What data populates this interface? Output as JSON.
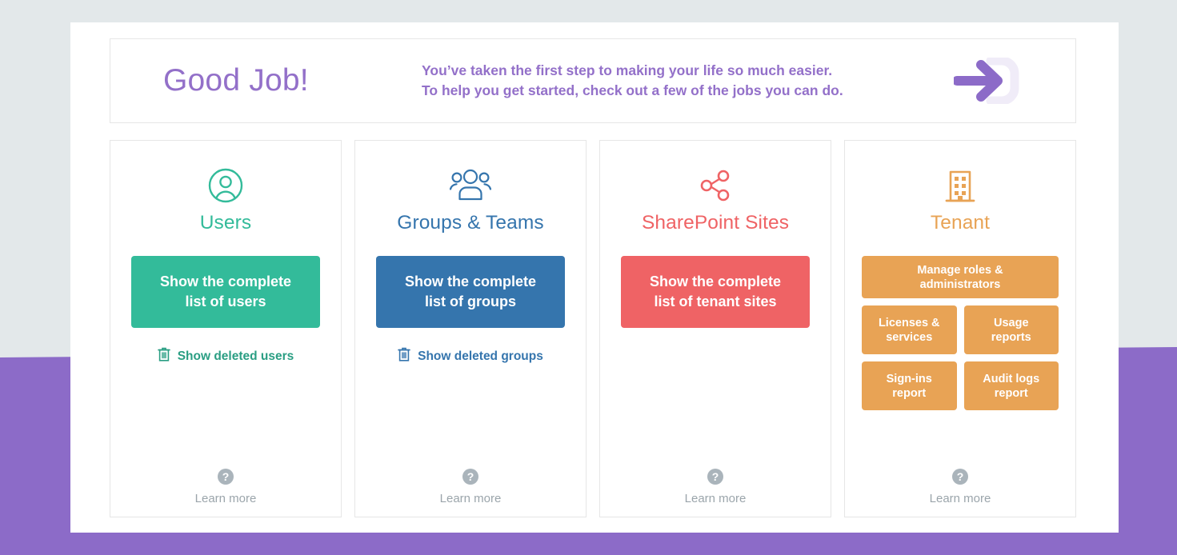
{
  "theme": {
    "background_top": "#e3e8ea",
    "background_bottom": "#8c6bc8",
    "panel": "#ffffff",
    "accent_purple": "#9370c9",
    "users_color": "#33bb9a",
    "groups_color": "#3575ad",
    "sharepoint_color": "#ef6365",
    "tenant_color": "#e8a355",
    "muted_gray": "#9ba5ab"
  },
  "banner": {
    "title": "Good Job!",
    "subtitle_line1": "You’ve taken the first step to making your life so much easier.",
    "subtitle_line2": "To help you get started, check out a few of the jobs you can do.",
    "icon": "arrow-enter-icon"
  },
  "cards": [
    {
      "id": "users",
      "icon": "user-circle-icon",
      "title": "Users",
      "color": "#33bb9a",
      "primary_button": "Show the complete list of users",
      "primary_button_line1": "Show the complete",
      "primary_button_line2": "list of users",
      "deleted_link": "Show deleted users",
      "deleted_icon": "trash-icon",
      "learn_more": "Learn more",
      "learn_more_icon": "question-mark-icon"
    },
    {
      "id": "groups",
      "icon": "people-group-icon",
      "title": "Groups & Teams",
      "color": "#3575ad",
      "primary_button": "Show the complete list of groups",
      "primary_button_line1": "Show the complete",
      "primary_button_line2": "list of groups",
      "deleted_link": "Show deleted groups",
      "deleted_icon": "trash-icon",
      "learn_more": "Learn more",
      "learn_more_icon": "question-mark-icon"
    },
    {
      "id": "sharepoint",
      "icon": "share-nodes-icon",
      "title": "SharePoint Sites",
      "color": "#ef6365",
      "primary_button": "Show the complete list of tenant sites",
      "primary_button_line1": "Show the complete",
      "primary_button_line2": "list of tenant sites",
      "deleted_link": null,
      "learn_more": "Learn more",
      "learn_more_icon": "question-mark-icon"
    },
    {
      "id": "tenant",
      "icon": "building-icon",
      "title": "Tenant",
      "color": "#e8a355",
      "buttons": [
        {
          "label": "Manage roles & administrators",
          "line1": "Manage roles &",
          "line2": "administrators"
        },
        {
          "label": "Licenses & services",
          "line1": "Licenses &",
          "line2": "services"
        },
        {
          "label": "Usage reports",
          "line1": "Usage",
          "line2": "reports"
        },
        {
          "label": "Sign-ins report",
          "line1": "Sign-ins",
          "line2": "report"
        },
        {
          "label": "Audit logs report",
          "line1": "Audit logs",
          "line2": "report"
        }
      ],
      "learn_more": "Learn more",
      "learn_more_icon": "question-mark-icon"
    }
  ]
}
